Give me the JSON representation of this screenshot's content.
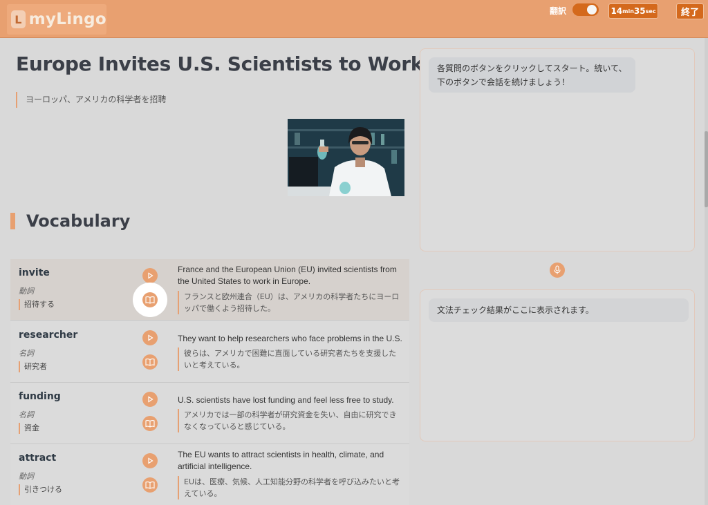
{
  "header": {
    "logo_text": "myLingo",
    "logo_mark": "L",
    "translate_label": "翻訳",
    "translate_on": true,
    "timer_min": "14",
    "timer_min_unit": "min",
    "timer_sec": "35",
    "timer_sec_unit": "sec",
    "end_label": "終了",
    "accent_color": "#e8a070",
    "button_color": "#d4691c"
  },
  "article": {
    "title": "Europe Invites U.S. Scientists to Work",
    "subtitle": "ヨーロッパ、アメリカの科学者を招聘"
  },
  "vocabulary": {
    "heading": "Vocabulary",
    "items": [
      {
        "word": "invite",
        "pos": "動詞",
        "meaning": "招待する",
        "sentence_en": "France and the European Union (EU) invited scientists from the United States to work in Europe.",
        "sentence_jp": "フランスと欧州連合（EU）は、アメリカの科学者たちにヨーロッパで働くよう招待した。"
      },
      {
        "word": "researcher",
        "pos": "名詞",
        "meaning": "研究者",
        "sentence_en": "They want to help researchers who face problems in the U.S.",
        "sentence_jp": "彼らは、アメリカで困難に直面している研究者たちを支援したいと考えている。"
      },
      {
        "word": "funding",
        "pos": "名詞",
        "meaning": "資金",
        "sentence_en": "U.S. scientists have lost funding and feel less free to study.",
        "sentence_jp": "アメリカでは一部の科学者が研究資金を失い、自由に研究できなくなっていると感じている。"
      },
      {
        "word": "attract",
        "pos": "動詞",
        "meaning": "引きつける",
        "sentence_en": "The EU wants to attract scientists in health, climate, and artificial intelligence.",
        "sentence_jp": "EUは、医療、気候、人工知能分野の科学者を呼び込みたいと考えている。"
      }
    ]
  },
  "chat": {
    "message": "各質問のボタンをクリックしてスタート。続いて、下のボタンで会話を続けましょう！"
  },
  "grammar": {
    "message": "文法チェック結果がここに表示されます。"
  },
  "icons": {
    "play": "play-icon",
    "book": "book-icon",
    "mic": "microphone-icon"
  }
}
